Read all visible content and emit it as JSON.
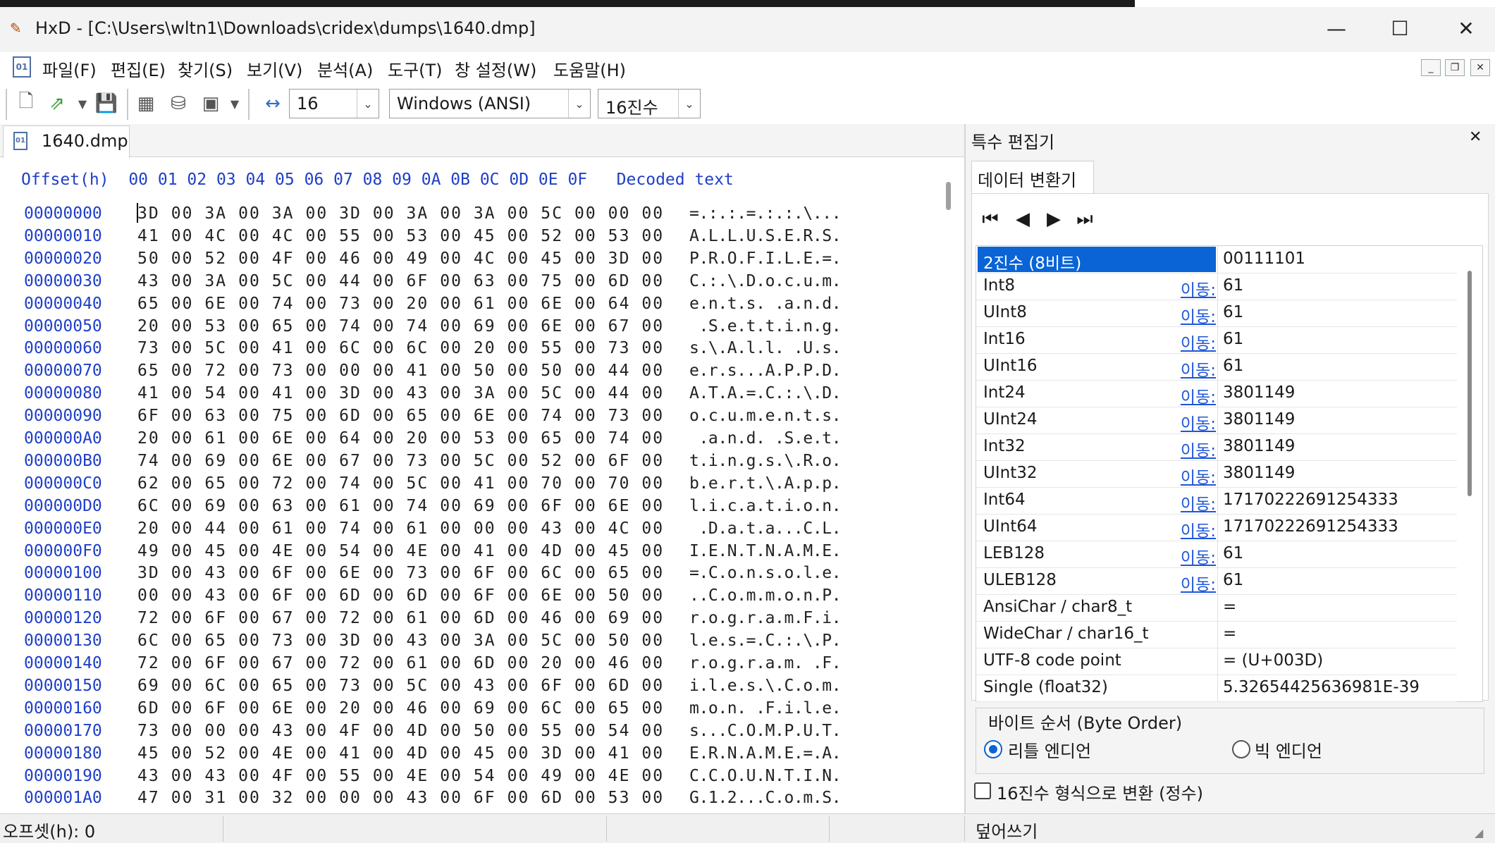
{
  "window": {
    "title": "HxD - [C:\\Users\\wltn1\\Downloads\\cridex\\dumps\\1640.dmp]",
    "minimize_glyph": "—",
    "maximize_glyph": "☐",
    "close_glyph": "✕"
  },
  "menu": {
    "items": [
      "파일(F)",
      "편집(E)",
      "찾기(S)",
      "보기(V)",
      "분석(A)",
      "도구(T)",
      "창 설정(W)",
      "도움말(H)"
    ]
  },
  "toolbar": {
    "bytes_per_row": "16",
    "encoding": "Windows (ANSI)",
    "offset_base": "16진수"
  },
  "file_tab": {
    "label": "1640.dmp"
  },
  "hex_view": {
    "header": "Offset(h)  00 01 02 03 04 05 06 07 08 09 0A 0B 0C 0D 0E 0F   Decoded text",
    "rows": [
      {
        "offset": "00000000",
        "bytes": "3D 00 3A 00 3A 00 3D 00 3A 00 3A 00 5C 00 00 00",
        "text": "=.:.:.=.:.:.\\..."
      },
      {
        "offset": "00000010",
        "bytes": "41 00 4C 00 4C 00 55 00 53 00 45 00 52 00 53 00",
        "text": "A.L.L.U.S.E.R.S."
      },
      {
        "offset": "00000020",
        "bytes": "50 00 52 00 4F 00 46 00 49 00 4C 00 45 00 3D 00",
        "text": "P.R.O.F.I.L.E.=."
      },
      {
        "offset": "00000030",
        "bytes": "43 00 3A 00 5C 00 44 00 6F 00 63 00 75 00 6D 00",
        "text": "C.:.\\.D.o.c.u.m."
      },
      {
        "offset": "00000040",
        "bytes": "65 00 6E 00 74 00 73 00 20 00 61 00 6E 00 64 00",
        "text": "e.n.t.s. .a.n.d."
      },
      {
        "offset": "00000050",
        "bytes": "20 00 53 00 65 00 74 00 74 00 69 00 6E 00 67 00",
        "text": " .S.e.t.t.i.n.g."
      },
      {
        "offset": "00000060",
        "bytes": "73 00 5C 00 41 00 6C 00 6C 00 20 00 55 00 73 00",
        "text": "s.\\.A.l.l. .U.s."
      },
      {
        "offset": "00000070",
        "bytes": "65 00 72 00 73 00 00 00 41 00 50 00 50 00 44 00",
        "text": "e.r.s...A.P.P.D."
      },
      {
        "offset": "00000080",
        "bytes": "41 00 54 00 41 00 3D 00 43 00 3A 00 5C 00 44 00",
        "text": "A.T.A.=.C.:.\\.D."
      },
      {
        "offset": "00000090",
        "bytes": "6F 00 63 00 75 00 6D 00 65 00 6E 00 74 00 73 00",
        "text": "o.c.u.m.e.n.t.s."
      },
      {
        "offset": "000000A0",
        "bytes": "20 00 61 00 6E 00 64 00 20 00 53 00 65 00 74 00",
        "text": " .a.n.d. .S.e.t."
      },
      {
        "offset": "000000B0",
        "bytes": "74 00 69 00 6E 00 67 00 73 00 5C 00 52 00 6F 00",
        "text": "t.i.n.g.s.\\.R.o."
      },
      {
        "offset": "000000C0",
        "bytes": "62 00 65 00 72 00 74 00 5C 00 41 00 70 00 70 00",
        "text": "b.e.r.t.\\.A.p.p."
      },
      {
        "offset": "000000D0",
        "bytes": "6C 00 69 00 63 00 61 00 74 00 69 00 6F 00 6E 00",
        "text": "l.i.c.a.t.i.o.n."
      },
      {
        "offset": "000000E0",
        "bytes": "20 00 44 00 61 00 74 00 61 00 00 00 43 00 4C 00",
        "text": " .D.a.t.a...C.L."
      },
      {
        "offset": "000000F0",
        "bytes": "49 00 45 00 4E 00 54 00 4E 00 41 00 4D 00 45 00",
        "text": "I.E.N.T.N.A.M.E."
      },
      {
        "offset": "00000100",
        "bytes": "3D 00 43 00 6F 00 6E 00 73 00 6F 00 6C 00 65 00",
        "text": "=.C.o.n.s.o.l.e."
      },
      {
        "offset": "00000110",
        "bytes": "00 00 43 00 6F 00 6D 00 6D 00 6F 00 6E 00 50 00",
        "text": "..C.o.m.m.o.n.P."
      },
      {
        "offset": "00000120",
        "bytes": "72 00 6F 00 67 00 72 00 61 00 6D 00 46 00 69 00",
        "text": "r.o.g.r.a.m.F.i."
      },
      {
        "offset": "00000130",
        "bytes": "6C 00 65 00 73 00 3D 00 43 00 3A 00 5C 00 50 00",
        "text": "l.e.s.=.C.:.\\.P."
      },
      {
        "offset": "00000140",
        "bytes": "72 00 6F 00 67 00 72 00 61 00 6D 00 20 00 46 00",
        "text": "r.o.g.r.a.m. .F."
      },
      {
        "offset": "00000150",
        "bytes": "69 00 6C 00 65 00 73 00 5C 00 43 00 6F 00 6D 00",
        "text": "i.l.e.s.\\.C.o.m."
      },
      {
        "offset": "00000160",
        "bytes": "6D 00 6F 00 6E 00 20 00 46 00 69 00 6C 00 65 00",
        "text": "m.o.n. .F.i.l.e."
      },
      {
        "offset": "00000170",
        "bytes": "73 00 00 00 43 00 4F 00 4D 00 50 00 55 00 54 00",
        "text": "s...C.O.M.P.U.T."
      },
      {
        "offset": "00000180",
        "bytes": "45 00 52 00 4E 00 41 00 4D 00 45 00 3D 00 41 00",
        "text": "E.R.N.A.M.E.=.A."
      },
      {
        "offset": "00000190",
        "bytes": "43 00 43 00 4F 00 55 00 4E 00 54 00 49 00 4E 00",
        "text": "C.C.O.U.N.T.I.N."
      },
      {
        "offset": "000001A0",
        "bytes": "47 00 31 00 32 00 00 00 43 00 6F 00 6D 00 53 00",
        "text": "G.1.2...C.o.m.S."
      }
    ]
  },
  "side_panel": {
    "title": "특수 편집기",
    "close_glyph": "✕",
    "tab": "데이터 변환기",
    "nav": [
      "⏮",
      "◀",
      "▶",
      "⏭"
    ],
    "goto_label": "이동:",
    "rows": [
      {
        "name": "2진수 (8비트)",
        "goto": false,
        "value": "00111101"
      },
      {
        "name": "Int8",
        "goto": true,
        "value": "61"
      },
      {
        "name": "UInt8",
        "goto": true,
        "value": "61"
      },
      {
        "name": "Int16",
        "goto": true,
        "value": "61"
      },
      {
        "name": "UInt16",
        "goto": true,
        "value": "61"
      },
      {
        "name": "Int24",
        "goto": true,
        "value": "3801149"
      },
      {
        "name": "UInt24",
        "goto": true,
        "value": "3801149"
      },
      {
        "name": "Int32",
        "goto": true,
        "value": "3801149"
      },
      {
        "name": "UInt32",
        "goto": true,
        "value": "3801149"
      },
      {
        "name": "Int64",
        "goto": true,
        "value": "17170222691254333"
      },
      {
        "name": "UInt64",
        "goto": true,
        "value": "17170222691254333"
      },
      {
        "name": "LEB128",
        "goto": true,
        "value": "61"
      },
      {
        "name": "ULEB128",
        "goto": true,
        "value": "61"
      },
      {
        "name": "AnsiChar / char8_t",
        "goto": false,
        "value": "="
      },
      {
        "name": "WideChar / char16_t",
        "goto": false,
        "value": "="
      },
      {
        "name": "UTF-8 code point",
        "goto": false,
        "value": "= (U+003D)"
      },
      {
        "name": "Single (float32)",
        "goto": false,
        "value": "5.32654425636981E-39"
      }
    ],
    "byte_order_label": "바이트 순서 (Byte Order)",
    "little_endian": "리틀 엔디언",
    "big_endian": "빅 엔디언",
    "hex_format_label": "16진수 형식으로 변환 (정수)"
  },
  "status": {
    "offset": "오프셋(h): 0",
    "mode": "덮어쓰기"
  },
  "colors": {
    "accent": "#0a64d6",
    "offset_blue": "#1f3fc9",
    "link_blue": "#1f56d8"
  }
}
